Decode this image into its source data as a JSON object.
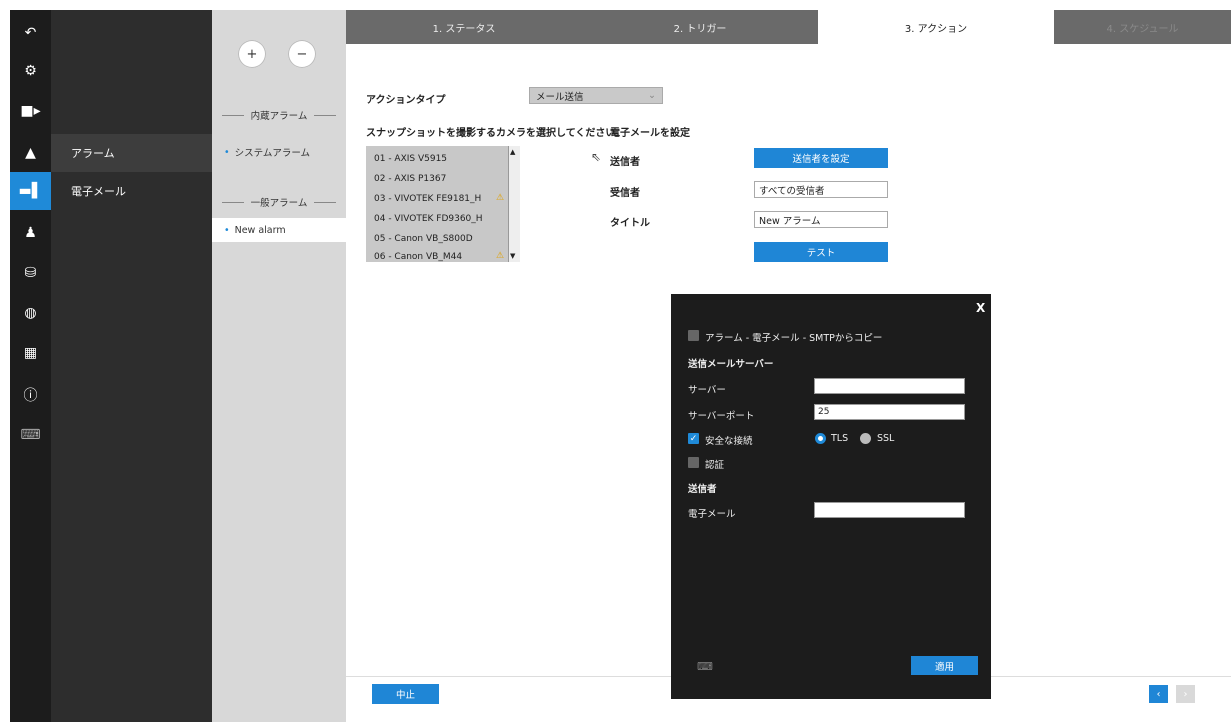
{
  "rail": {
    "icons": [
      "back-icon",
      "gear-icon",
      "camera-icon",
      "alarm-bell-icon",
      "monitor-icon",
      "user-icon",
      "database-icon",
      "globe-icon",
      "grid-icon",
      "info-icon",
      "keyboard-icon"
    ]
  },
  "menu": {
    "items": [
      {
        "label": "アラーム"
      },
      {
        "label": "電子メール"
      }
    ]
  },
  "list": {
    "add_label": "+",
    "remove_label": "−",
    "builtin_header": "内蔵アラーム",
    "builtin_item": "システムアラーム",
    "general_header": "一般アラーム",
    "general_item": "New alarm"
  },
  "steps": [
    {
      "label": "1. ステータス"
    },
    {
      "label": "2. トリガー"
    },
    {
      "label": "3. アクション"
    },
    {
      "label": "4. スケジュール"
    }
  ],
  "action": {
    "type_label": "アクションタイプ",
    "type_value": "メール送信",
    "camera_prompt": "スナップショットを撮影するカメラを選択してください",
    "email_header": "電子メールを設定",
    "cameras": [
      {
        "name": "01 - AXIS V5915",
        "warn": false
      },
      {
        "name": "02 - AXIS P1367",
        "warn": false
      },
      {
        "name": "03 - VIVOTEK FE9181_H",
        "warn": true
      },
      {
        "name": "04 - VIVOTEK FD9360_H",
        "warn": false
      },
      {
        "name": "05 - Canon VB_S800D",
        "warn": false
      },
      {
        "name": "06 - Canon VB_M44",
        "warn": true
      }
    ],
    "sender_label": "送信者",
    "sender_button": "送信者を設定",
    "recipient_label": "受信者",
    "recipient_value": "すべての受信者",
    "title_label": "タイトル",
    "title_value": "New アラーム",
    "test_button": "テスト",
    "cancel_button": "中止"
  },
  "modal": {
    "close": "X",
    "copy_label": "アラーム - 電子メール - SMTPからコピー",
    "server_section": "送信メールサーバー",
    "server_label": "サーバー",
    "server_value": "",
    "port_label": "サーバーポート",
    "port_value": "25",
    "secure_label": "安全な接続",
    "tls_label": "TLS",
    "ssl_label": "SSL",
    "auth_label": "認証",
    "sender_section": "送信者",
    "email_label": "電子メール",
    "email_value": "",
    "apply_button": "適用"
  },
  "colors": {
    "accent": "#1f8ad8",
    "rail": "#1c1c1c",
    "menu": "#2d2d2d",
    "steps": "#6a6a6a"
  }
}
